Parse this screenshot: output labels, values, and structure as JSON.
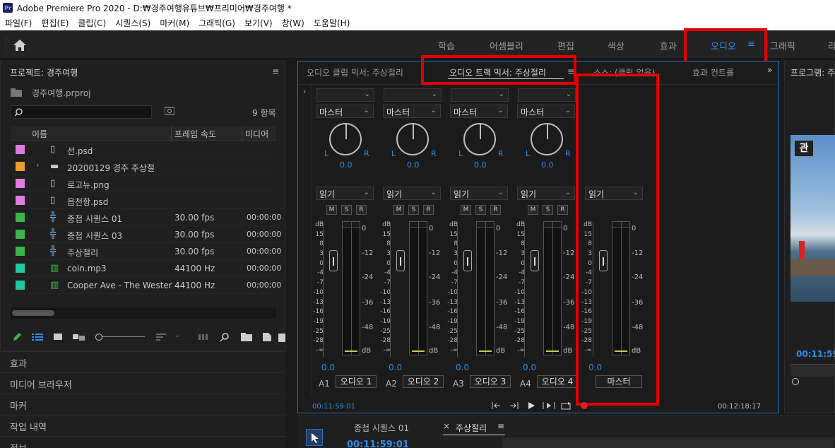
{
  "window": {
    "app_icon": "Pr",
    "title": "Adobe Premiere Pro 2020 - D:₩경주여행유튜브₩프리미어₩경주여행 *"
  },
  "menu": [
    "파일(F)",
    "편집(E)",
    "클립(C)",
    "시퀀스(S)",
    "마커(M)",
    "그래픽(G)",
    "보기(V)",
    "창(W)",
    "도움말(H)"
  ],
  "workspaces": [
    "학습",
    "어셈블리",
    "편집",
    "색상",
    "효과",
    "오디오",
    "그래픽",
    "라"
  ],
  "active_workspace_menu": "≡",
  "project": {
    "title": "프로젝트: 경주여행",
    "file": "경주여행.prproj",
    "item_count": "9 항목",
    "columns": [
      "이름",
      "프레임 속도",
      "미디어"
    ],
    "items": [
      {
        "name": "선.psd",
        "fps": "",
        "tc": "",
        "color": "#e07be0",
        "icon": "psd-icon"
      },
      {
        "name": "20200129 경주 주상절",
        "fps": "",
        "tc": "",
        "color": "#e8a030",
        "icon": "folder-icon"
      },
      {
        "name": "로고뉴.png",
        "fps": "",
        "tc": "",
        "color": "#e07be0",
        "icon": "png-icon"
      },
      {
        "name": "읍천항.psd",
        "fps": "",
        "tc": "",
        "color": "#e07be0",
        "icon": "psd-icon"
      },
      {
        "name": "중첩 시퀀스 01",
        "fps": "30.00 fps",
        "tc": "00:00:00",
        "color": "#3cb44b",
        "icon": "sequence-icon"
      },
      {
        "name": "중첩 시퀀스 03",
        "fps": "30.00 fps",
        "tc": "00:00:00",
        "color": "#3cb44b",
        "icon": "sequence-icon"
      },
      {
        "name": "주상절리",
        "fps": "30.00 fps",
        "tc": "00:00:00",
        "color": "#3cb44b",
        "icon": "sequence-icon"
      },
      {
        "name": "coin.mp3",
        "fps": "44100 Hz",
        "tc": "00;00;00",
        "color": "#20c8a0",
        "icon": "audio-icon"
      },
      {
        "name": "Cooper Ave - The Wester",
        "fps": "44100 Hz",
        "tc": "00;00;00",
        "color": "#20c8a0",
        "icon": "audio-icon"
      }
    ]
  },
  "left_panels": [
    "효과",
    "미디어 브라우저",
    "마커",
    "작업 내역",
    "정보"
  ],
  "mixer_tabs": {
    "clip_mixer": "오디오 클립 믹서: 주상절리",
    "track_mixer": "오디오 트랙 믹서: 주상절리",
    "source": "소스: (클립 없음)",
    "effect_controls": "효과 컨트롤",
    "more": "»"
  },
  "program_title": "프로그램: 주",
  "channels": [
    {
      "id": "A1",
      "route": "마스터",
      "pan": "0.0",
      "auto": "읽기",
      "level": "0.0",
      "name": "오디오 1"
    },
    {
      "id": "A2",
      "route": "마스터",
      "pan": "0.0",
      "auto": "읽기",
      "level": "0.0",
      "name": "오디오 2"
    },
    {
      "id": "A3",
      "route": "마스터",
      "pan": "0.0",
      "auto": "읽기",
      "level": "0.0",
      "name": "오디오 3"
    },
    {
      "id": "A4",
      "route": "마스터",
      "pan": "0.0",
      "auto": "읽기",
      "level": "0.0",
      "name": "오디오 4"
    }
  ],
  "master": {
    "auto": "읽기",
    "level": "0.0",
    "name": "마스터"
  },
  "msr": [
    "M",
    "S",
    "R"
  ],
  "lr": [
    "L",
    "R"
  ],
  "fader_scale": [
    "dB",
    "15",
    "8",
    "3",
    "0",
    "-4",
    "-7",
    "-10",
    "-13",
    "-16",
    "-19",
    "-25",
    "-28",
    "-∞"
  ],
  "meter_scale": [
    "0",
    "-12",
    "-24",
    "-36",
    "-48",
    "dB"
  ],
  "timecode_left": "00:11:59:01",
  "timecode_right": "00:12:18:17",
  "program_tc": "00:11:59",
  "timeline_tabs": {
    "t1": "중첩 시퀀스 01",
    "t2": "주상절리",
    "close": "×",
    "menu": "≡"
  },
  "timeline_tc": "00:11:59:01",
  "colors": {
    "accent": "#2d8ceb",
    "highlight": "#e00000"
  }
}
